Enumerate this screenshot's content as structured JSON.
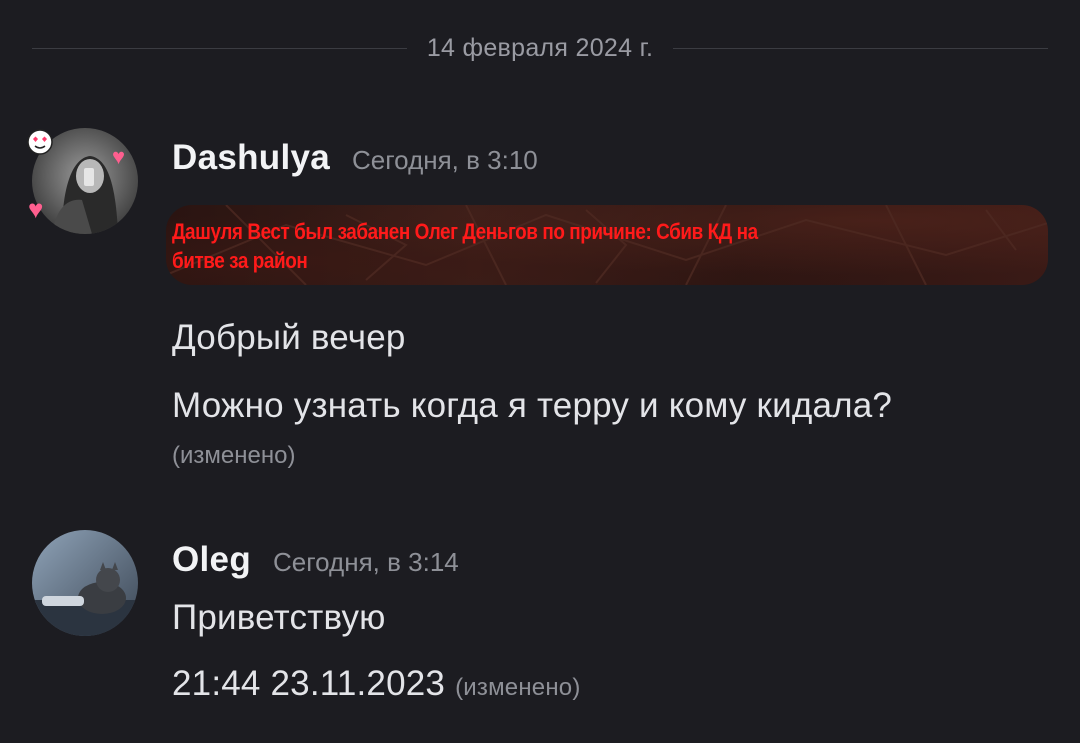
{
  "date_divider": "14 февраля 2024 г.",
  "messages": [
    {
      "username": "Dashulya",
      "timestamp": "Сегодня, в 3:10",
      "banner_line1": "Дашуля Вест был забанен Олег Деньгов по причине: Сбив КД на",
      "banner_line2": "битве за район",
      "lines": [
        "Добрый вечер",
        "Можно узнать когда я терру и кому кидала?"
      ],
      "edited_label": "(изменено)"
    },
    {
      "username": "Oleg",
      "timestamp": "Сегодня, в 3:14",
      "lines": [
        "Приветствую",
        "21:44 23.11.2023"
      ],
      "edited_label": "(изменено)"
    }
  ],
  "colors": {
    "background": "#1c1c21",
    "banner_text": "#ff1a1a",
    "username": "#f2f3f5",
    "muted": "#8e9097"
  },
  "icons": {
    "decor": [
      "heart-eyes-emoji-icon",
      "heart-icon"
    ]
  }
}
